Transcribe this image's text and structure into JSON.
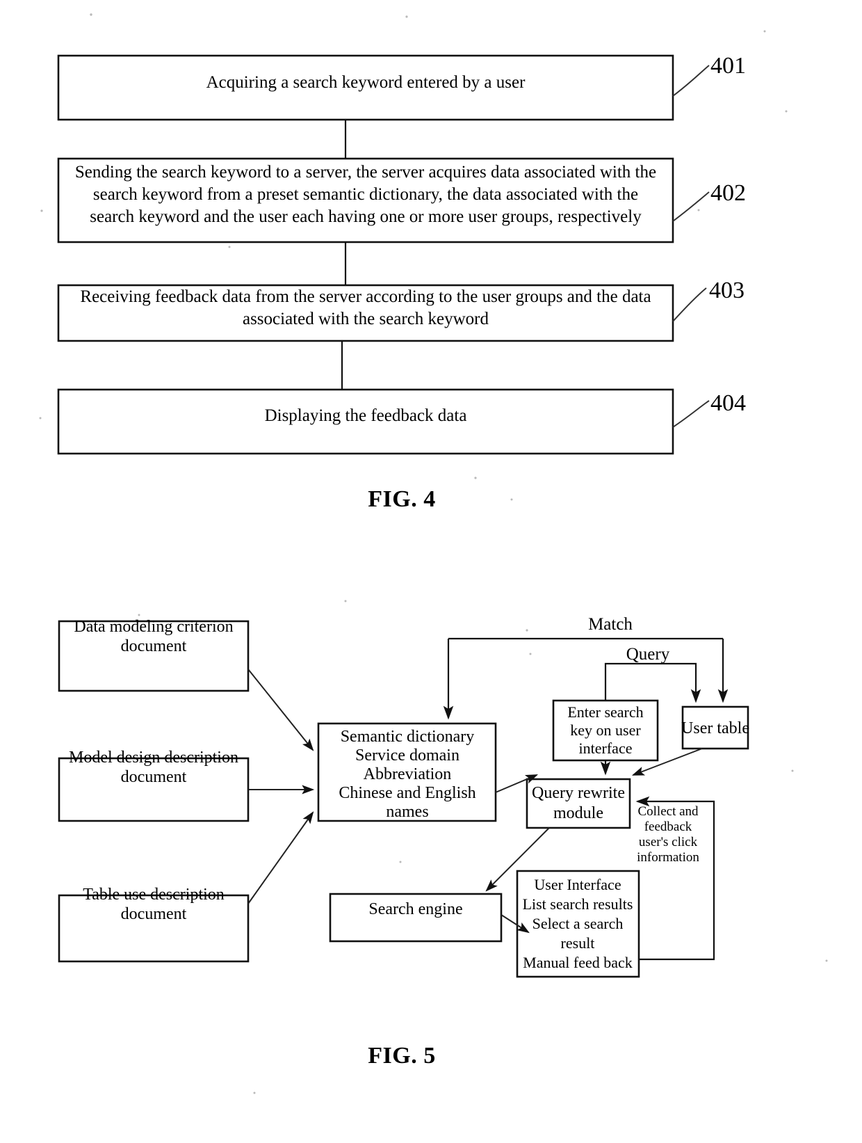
{
  "figure4": {
    "caption": "FIG. 4",
    "steps": [
      {
        "ref": "401",
        "lines": [
          "Acquiring a search keyword entered by a user"
        ]
      },
      {
        "ref": "402",
        "lines": [
          "Sending the search keyword to a server, the server acquires data associated with the",
          "search keyword from a preset semantic dictionary, the data associated with the",
          "search keyword and the user each having one or more user groups, respectively"
        ]
      },
      {
        "ref": "403",
        "lines": [
          "Receiving feedback data from the server according to the user groups and the data",
          "associated with the search keyword"
        ]
      },
      {
        "ref": "404",
        "lines": [
          "Displaying the feedback data"
        ]
      }
    ]
  },
  "figure5": {
    "caption": "FIG. 5",
    "nodes": {
      "data_modeling": [
        "Data modeling criterion",
        "document"
      ],
      "model_design": [
        "Model design description",
        "document"
      ],
      "table_use": [
        "Table use description",
        "document"
      ],
      "semantic_dictionary": [
        "Semantic dictionary",
        "Service domain",
        "Abbreviation",
        "Chinese and English",
        "names"
      ],
      "enter_search_key": [
        "Enter search",
        "key on user",
        "interface"
      ],
      "user_table": [
        "User table"
      ],
      "query_rewrite": [
        "Query rewrite",
        "module"
      ],
      "search_engine": [
        "Search engine"
      ],
      "user_interface": [
        "User Interface",
        "List search results",
        "Select a search",
        "result",
        "Manual feed back"
      ]
    },
    "edge_labels": {
      "match": "Match",
      "query": "Query",
      "feedback": [
        "Collect and",
        "feedback",
        "user's click",
        "information"
      ]
    }
  },
  "colors": {
    "ink": "#111111",
    "paper": "#ffffff"
  }
}
